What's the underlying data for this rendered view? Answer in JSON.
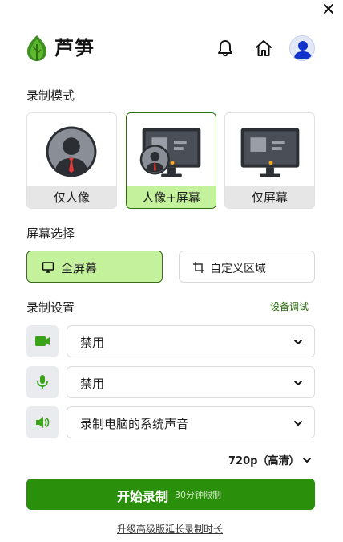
{
  "window": {
    "close_icon": "close-icon"
  },
  "header": {
    "brand": "芦笋",
    "logo_icon": "leaf-logo",
    "icons": [
      "bell-icon",
      "home-icon",
      "user-avatar-icon"
    ]
  },
  "record_mode": {
    "title": "录制模式",
    "options": [
      {
        "label": "仅人像",
        "active": false
      },
      {
        "label": "人像+屏幕",
        "active": true
      },
      {
        "label": "仅屏幕",
        "active": false
      }
    ]
  },
  "screen_select": {
    "title": "屏幕选择",
    "full_screen": "全屏幕",
    "custom_area": "自定义区域"
  },
  "record_settings": {
    "title": "录制设置",
    "device_test": "设备调试",
    "camera": "禁用",
    "microphone": "禁用",
    "audio": "录制电脑的系统声音"
  },
  "quality": "720p（高清）",
  "start": {
    "label": "开始录制",
    "limit": "30分钟限制"
  },
  "upgrade_link": "升级高级版延长录制时长",
  "colors": {
    "accent": "#2a8f0a",
    "active_bg": "#c4f29c",
    "icon_green": "#3aa317"
  }
}
